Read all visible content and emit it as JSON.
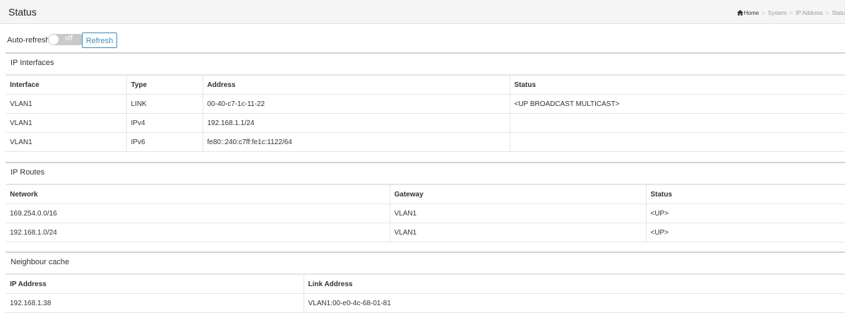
{
  "header": {
    "title": "Status",
    "breadcrumb": [
      "Home",
      "System",
      "IP Address",
      "Statu"
    ]
  },
  "toolbar": {
    "auto_refresh_label": "Auto-refresh",
    "toggle_text": "off",
    "refresh_label": "Refresh"
  },
  "ip_interfaces": {
    "title": "IP Interfaces",
    "columns": [
      "Interface",
      "Type",
      "Address",
      "Status"
    ],
    "rows": [
      [
        "VLAN1",
        "LINK",
        "00-40-c7-1c-11-22",
        "<UP BROADCAST MULTICAST>"
      ],
      [
        "VLAN1",
        "IPv4",
        "192.168.1.1/24",
        ""
      ],
      [
        "VLAN1",
        "IPv6",
        "fe80::240:c7ff:fe1c:1122/64",
        ""
      ]
    ]
  },
  "ip_routes": {
    "title": "IP Routes",
    "columns": [
      "Network",
      "Gateway",
      "Status"
    ],
    "rows": [
      [
        "169.254.0.0/16",
        "VLAN1",
        "<UP>"
      ],
      [
        "192.168.1.0/24",
        "VLAN1",
        "<UP>"
      ]
    ]
  },
  "neighbour_cache": {
    "title": "Neighbour cache",
    "columns": [
      "IP Address",
      "Link Address"
    ],
    "rows": [
      [
        "192.168.1.38",
        "VLAN1:00-e0-4c-68-01-81"
      ]
    ]
  },
  "colors": {
    "accent": "#3c8dbc",
    "toggle_off": "#c9c9c9",
    "header_bg": "#f5f5f5",
    "border": "#e5e5e5"
  }
}
